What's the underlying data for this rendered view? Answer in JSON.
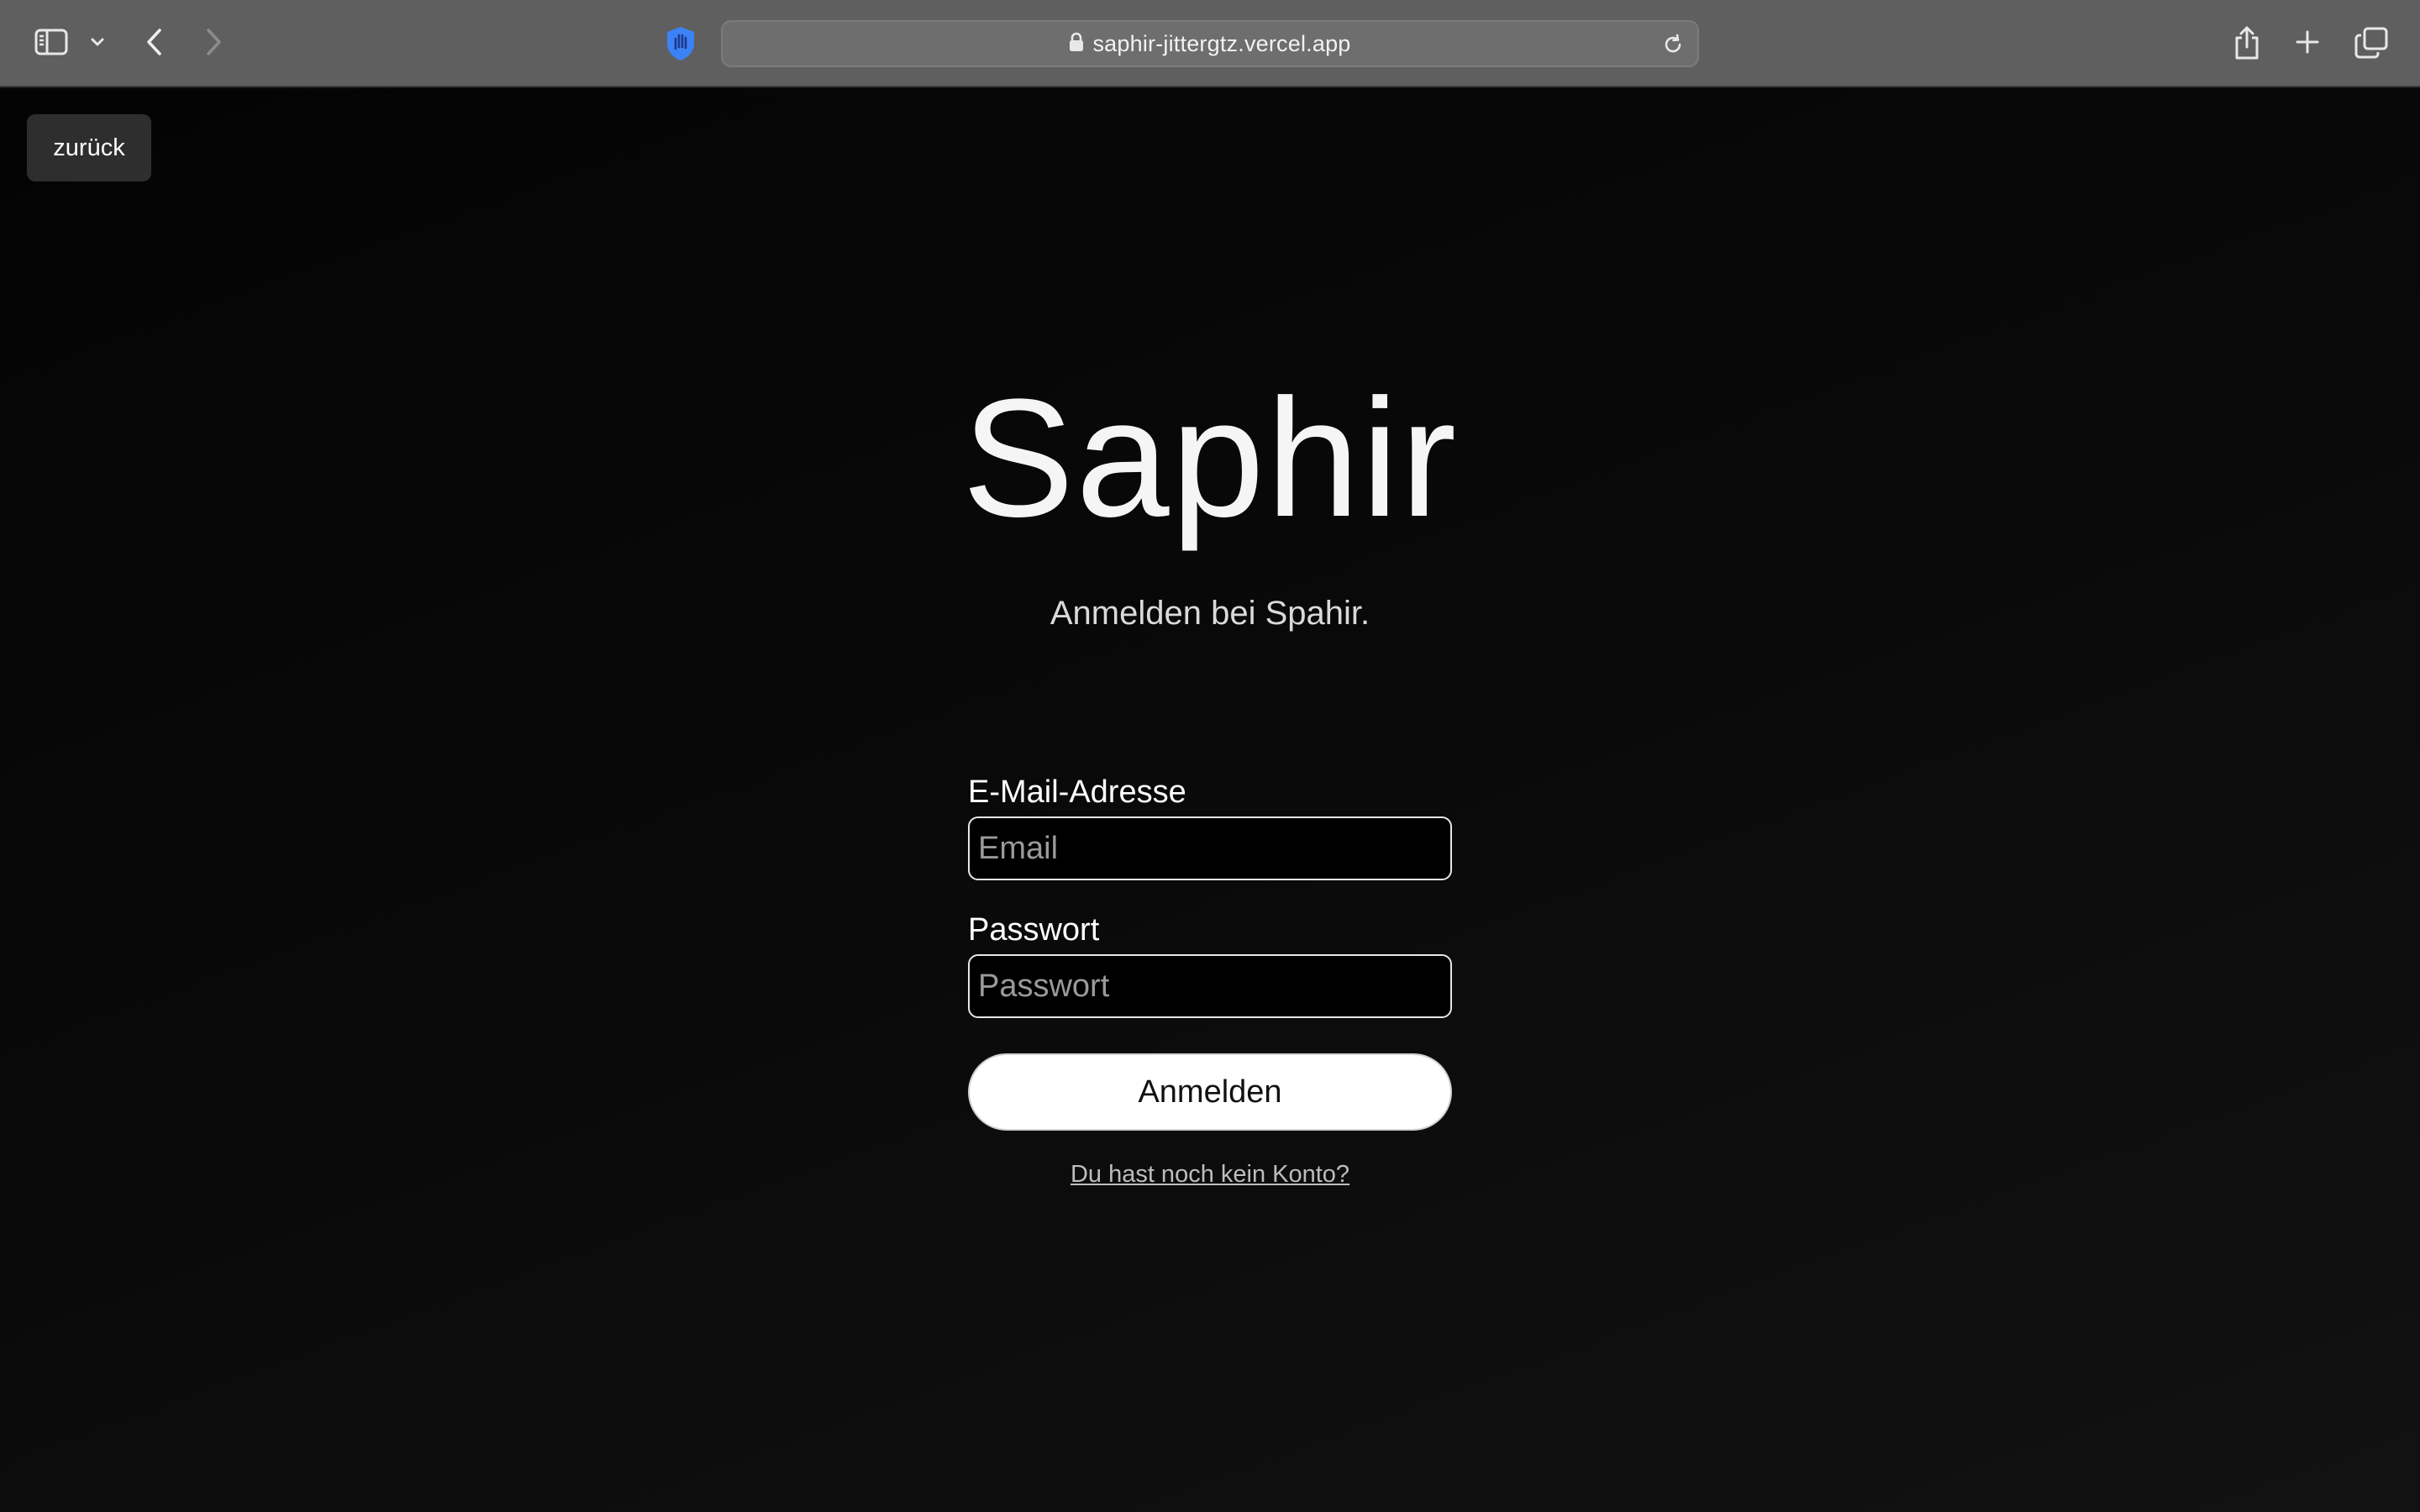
{
  "browser": {
    "url": "saphir-jittergtz.vercel.app",
    "icons": {
      "sidebar": "sidebar-icon",
      "sidebar_menu": "chevron-down-icon",
      "back": "chevron-left-icon",
      "forward": "chevron-right-icon",
      "privacy": "shield-hand-icon",
      "lock": "lock-icon",
      "reload": "reload-icon",
      "share": "share-icon",
      "new_tab": "plus-icon",
      "tab_overview": "tab-overview-icon"
    },
    "accent_color": "#3b82f6"
  },
  "page": {
    "back_button_label": "zurück",
    "title": "Saphir",
    "subtitle": "Anmelden bei Spahir.",
    "form": {
      "email_label": "E-Mail-Adresse",
      "email_placeholder": "Email",
      "email_value": "",
      "password_label": "Passwort",
      "password_placeholder": "Passwort",
      "password_value": "",
      "submit_label": "Anmelden",
      "register_link": "Du hast noch kein Konto?"
    }
  }
}
